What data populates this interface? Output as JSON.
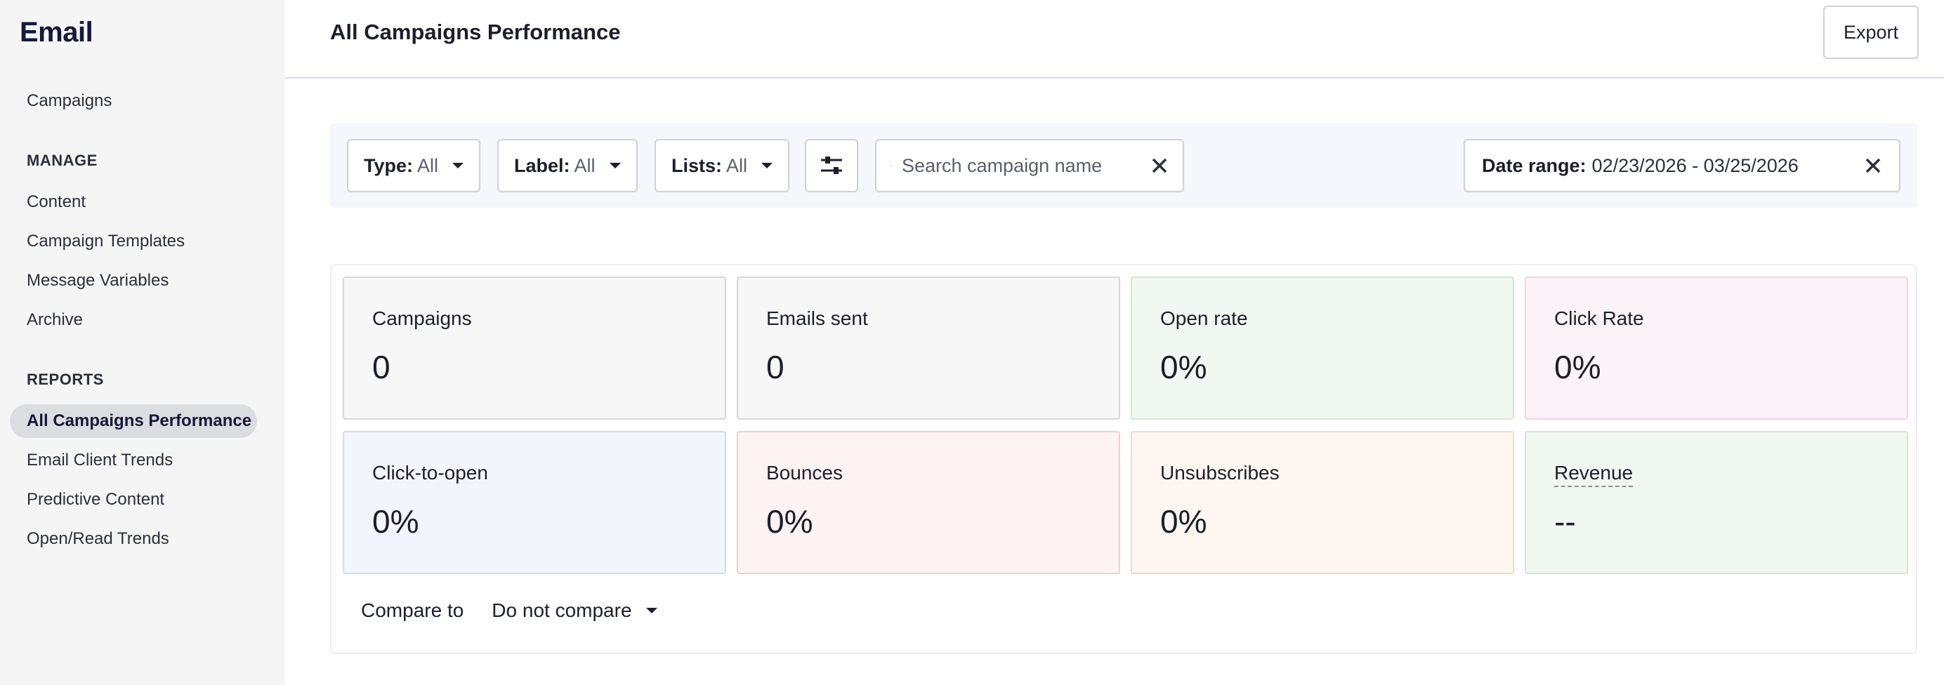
{
  "sidebar": {
    "app_title": "Email",
    "top_item": "Campaigns",
    "manage_heading": "MANAGE",
    "manage_items": [
      "Content",
      "Campaign Templates",
      "Message Variables",
      "Archive"
    ],
    "reports_heading": "REPORTS",
    "reports_items": [
      "All Campaigns Performance",
      "Email Client Trends",
      "Predictive Content",
      "Open/Read Trends"
    ],
    "active_item": "All Campaigns Performance"
  },
  "header": {
    "title": "All Campaigns Performance",
    "export_label": "Export"
  },
  "filters": {
    "type": {
      "label": "Type:",
      "value": "All"
    },
    "label": {
      "label": "Label:",
      "value": "All"
    },
    "lists": {
      "label": "Lists:",
      "value": "All"
    },
    "search_placeholder": "Search campaign name",
    "date_range": {
      "label": "Date range:",
      "value": "02/23/2026 - 03/25/2026"
    }
  },
  "metrics": [
    {
      "label": "Campaigns",
      "value": "0",
      "bg": "#f7f7f7",
      "border": "#d6d6d6"
    },
    {
      "label": "Emails sent",
      "value": "0",
      "bg": "#f7f7f7",
      "border": "#d6d6d6"
    },
    {
      "label": "Open rate",
      "value": "0%",
      "bg": "#f1f8f2",
      "border": "#cfe6d4"
    },
    {
      "label": "Click Rate",
      "value": "0%",
      "bg": "#fcf3f8",
      "border": "#efd3e3"
    },
    {
      "label": "Click-to-open",
      "value": "0%",
      "bg": "#f3f5fc",
      "border": "#d5dbef"
    },
    {
      "label": "Bounces",
      "value": "0%",
      "bg": "#fdf3f2",
      "border": "#f1cfcb"
    },
    {
      "label": "Unsubscribes",
      "value": "0%",
      "bg": "#fef7f1",
      "border": "#f4dcc6"
    },
    {
      "label": "Revenue",
      "value": "--",
      "bg": "#f1f8f2",
      "border": "#cfe6d4"
    }
  ],
  "compare": {
    "label": "Compare to",
    "value": "Do not compare"
  }
}
